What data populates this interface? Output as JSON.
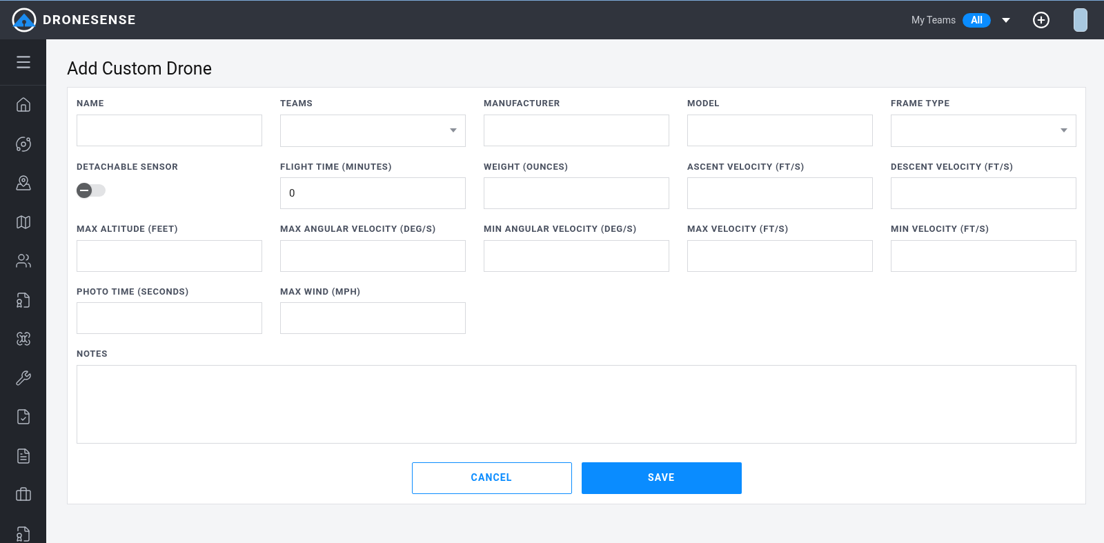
{
  "header": {
    "brand": "DRONESENSE",
    "teams_label": "My Teams",
    "teams_badge": "All"
  },
  "sidebar": {
    "items": [
      {
        "selected": false
      },
      {
        "selected": false
      },
      {
        "selected": false
      },
      {
        "selected": false
      },
      {
        "selected": false
      },
      {
        "selected": false
      },
      {
        "selected": false
      },
      {
        "selected": false
      },
      {
        "selected": false
      },
      {
        "selected": false
      },
      {
        "selected": false
      },
      {
        "selected": false
      }
    ]
  },
  "page": {
    "title": "Add Custom Drone"
  },
  "form": {
    "fields": [
      {
        "kind": "text",
        "label": "NAME"
      },
      {
        "kind": "select",
        "label": "TEAMS"
      },
      {
        "kind": "text",
        "label": "MANUFACTURER"
      },
      {
        "kind": "text",
        "label": "MODEL"
      },
      {
        "kind": "select",
        "label": "FRAME TYPE"
      },
      {
        "kind": "toggle",
        "label": "DETACHABLE SENSOR",
        "on": false
      },
      {
        "kind": "text",
        "label": "FLIGHT TIME (MINUTES)",
        "value": "0"
      },
      {
        "kind": "text",
        "label": "WEIGHT (OUNCES)"
      },
      {
        "kind": "text",
        "label": "ASCENT VELOCITY (FT/S)"
      },
      {
        "kind": "text",
        "label": "DESCENT VELOCITY (FT/S)"
      },
      {
        "kind": "text",
        "label": "MAX ALTITUDE (FEET)"
      },
      {
        "kind": "text",
        "label": "MAX ANGULAR VELOCITY (DEG/S)"
      },
      {
        "kind": "text",
        "label": "MIN ANGULAR VELOCITY (DEG/S)"
      },
      {
        "kind": "text",
        "label": "MAX VELOCITY (FT/S)"
      },
      {
        "kind": "text",
        "label": "MIN VELOCITY (FT/S)"
      },
      {
        "kind": "text",
        "label": "PHOTO TIME (SECONDS)"
      },
      {
        "kind": "text",
        "label": "MAX WIND (MPH)"
      },
      {
        "kind": "textarea",
        "label": "NOTES"
      }
    ],
    "buttons": [
      {
        "kind": "secondary",
        "label": "CANCEL"
      },
      {
        "kind": "primary",
        "label": "SAVE"
      }
    ]
  }
}
